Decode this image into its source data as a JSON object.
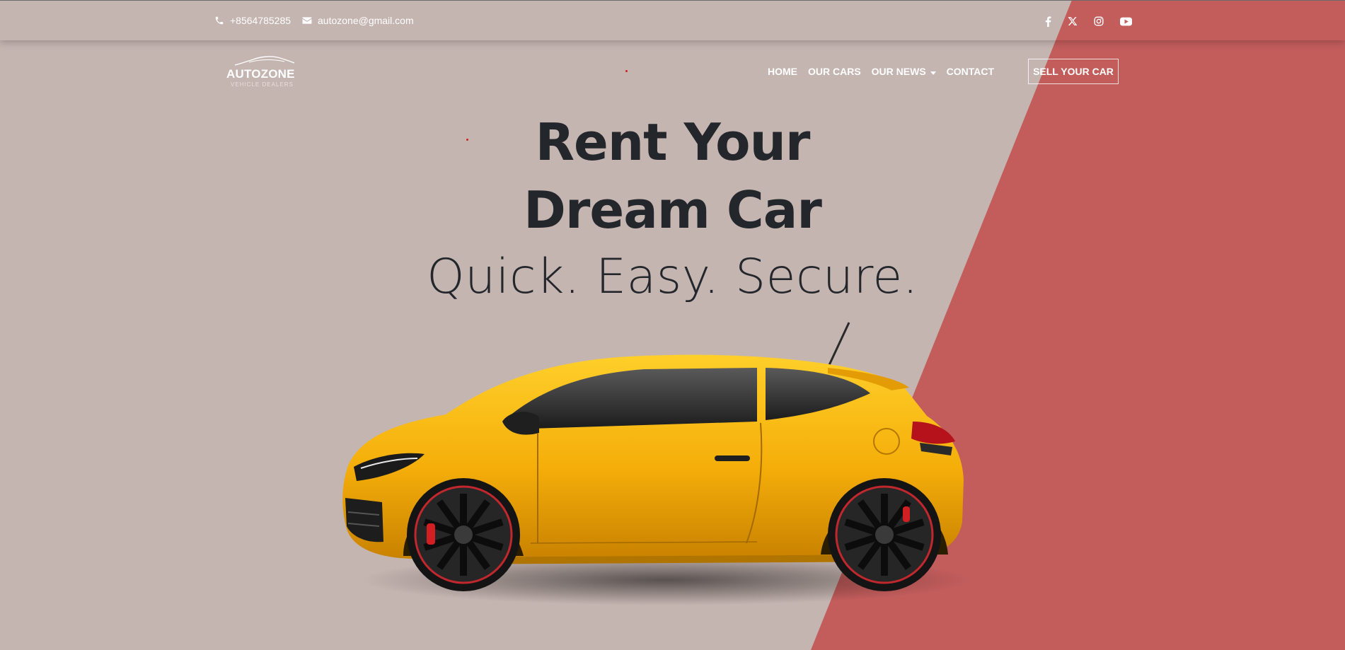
{
  "topbar": {
    "phone": "+8564785285",
    "email": "autozone@gmail.com",
    "social": [
      {
        "name": "facebook-icon"
      },
      {
        "name": "x-icon"
      },
      {
        "name": "instagram-icon"
      },
      {
        "name": "youtube-icon"
      }
    ]
  },
  "logo": {
    "brand": "AUTOZONE",
    "tagline": "VEHICLE DEALERS"
  },
  "nav": {
    "items": [
      {
        "label": "HOME"
      },
      {
        "label": "OUR CARS"
      },
      {
        "label": "OUR NEWS",
        "has_dropdown": true
      },
      {
        "label": "CONTACT"
      }
    ],
    "cta_label": "SELL YOUR CAR"
  },
  "hero": {
    "title_line1": "Rent Your",
    "title_line2": "Dream Car",
    "subtitle": "Quick. Easy. Secure."
  },
  "colors": {
    "background": "#c5b5b1",
    "accent_band": "#c25d5c",
    "heading": "#23262b",
    "car_body": "#f5b20c"
  }
}
